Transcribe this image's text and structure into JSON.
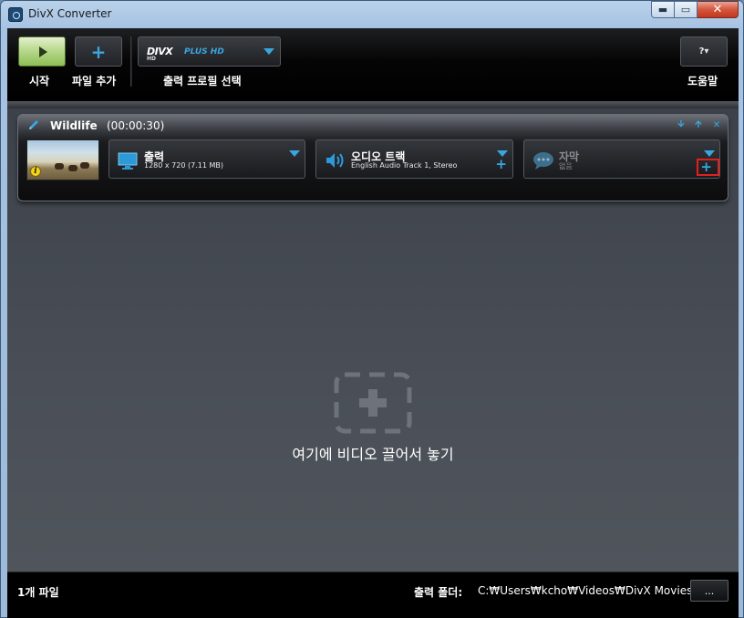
{
  "window": {
    "title": "DivX Converter",
    "caption": {
      "minimize": "▬",
      "maximize": "▭",
      "close": "✕"
    }
  },
  "toolbar": {
    "start_label": "시작",
    "add_file_label": "파일 추가",
    "profile_logo": "DIVX",
    "profile_logo_sub": "HD",
    "profile_name": "PLUS HD",
    "profile_label": "출력 프로필 선택",
    "help_icon_text": "?▾",
    "help_label": "도움말"
  },
  "file_card": {
    "name": "Wildlife",
    "duration": "(00:00:30)",
    "output": {
      "title": "출력",
      "detail": "1280 x 720 (7.11 MB)"
    },
    "audio": {
      "title": "오디오 트랙",
      "detail": "English Audio Track 1, Stereo"
    },
    "subtitle": {
      "title": "자막",
      "detail": "없음"
    }
  },
  "dropzone": {
    "text": "여기에 비디오 끌어서 놓기"
  },
  "statusbar": {
    "file_count": "1개 파일",
    "folder_label": "출력 폴더:",
    "folder_path": "C:₩Users₩kcho₩Videos₩DivX Movies",
    "browse_label": "..."
  },
  "colors": {
    "accent": "#3aa6e0",
    "start_green": "#8ebe55",
    "highlight_red": "#e02020"
  },
  "icons": [
    "app-icon",
    "play-icon",
    "plus-icon",
    "pencil-icon",
    "monitor-icon",
    "speaker-icon",
    "speech-bubble-icon",
    "info-icon",
    "drop-target-icon"
  ]
}
